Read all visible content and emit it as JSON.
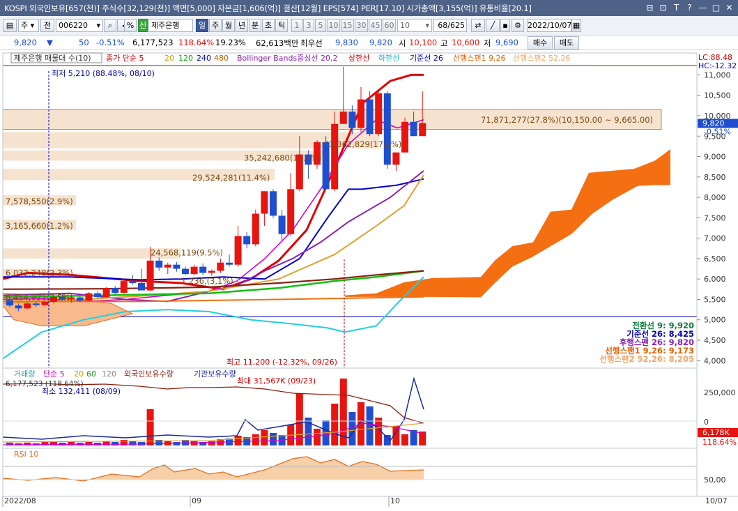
{
  "title": "KOSPI 외국인보유[657(천)] 주식수[32,129(천)] 액면[5,000] 자본금[1,606(억)] 결산[12월] EPS[574] PER[17.10] 시가총액[3,155(억)] 유통비율[20.1]",
  "window_buttons": [
    "⊟",
    "⊡",
    "T",
    "?",
    "—",
    "□",
    "✕"
  ],
  "toolbar": {
    "market": "주",
    "prev": "전",
    "code": "006220",
    "search_icon": "search-icon",
    "percent": "%",
    "sin": "신",
    "stock_name": "제주은행",
    "periods": [
      "일",
      "주",
      "월",
      "년",
      "분",
      "초",
      "틱"
    ],
    "active_period": "일",
    "nums": [
      "1",
      "3",
      "5",
      "10",
      "15",
      "30",
      "45",
      "60"
    ],
    "interval": "10",
    "count": "68",
    "total": "/625",
    "date": "2022/10/07"
  },
  "quote": {
    "price": "9,820",
    "arrow": "▼",
    "change": "50",
    "change_pct": "-0.51%",
    "volume": "6,177,523",
    "vol_ratio": "118.64%",
    "turnover": "19.23%",
    "amount": "62,613백만",
    "pref_label": "최우선",
    "pref1": "9,830",
    "pref2": "9,820",
    "open_label": "시",
    "open": "10,100",
    "high_label": "고",
    "high": "10,600",
    "low_label": "저",
    "low": "9,690",
    "buy": "매수",
    "sell": "매도"
  },
  "main_legend": {
    "name": "제주은행 매물대 수(10)",
    "ma_label": "종가 단순 5",
    "ma_periods": [
      "20",
      "120",
      "240",
      "480"
    ],
    "bb": "Bollinger Bands중심선 20,2",
    "upper": "상한선",
    "lower": "하한선",
    "base": "기준선 26",
    "lead1": "선행스팬1 9,26",
    "lead2": "선행스팬2 52,26"
  },
  "right_tags": {
    "lc": "LC:88.48",
    "hc": "HC:-12.32",
    "price": "9,820",
    "pct": "-0.51%",
    "vol": "6,178K",
    "volpct": "118.64%"
  },
  "annotations": {
    "low": "최저 5,210 (88.48%, 08/10)",
    "high": "최고 11,200 (-12.32%, 09/26)",
    "vol_max": "최대 31,567K (09/23)",
    "vol_min": "최소 132,411 (08/09)",
    "vol_cur": "6,177,523 (118.64%)"
  },
  "vp_labels": [
    "71,871,277(27.8%)(10,150.00 ~ 9,665.00)",
    "43,362,829(17.0%)",
    "35,242,680(13.7%)",
    "29,524,281(11.4%)",
    "7,578,550(2.9%)",
    "3,165,660(1.2%)",
    "24,568,119(9.5%)",
    "6,032,248(2.3%)",
    "6,454,923(2.5%)",
    "1,236,(3,1%)"
  ],
  "ichimoku": [
    {
      "label": "전환선 9: 9,920",
      "color": "#0a7a3a"
    },
    {
      "label": "기준선 26: 8,425",
      "color": "#0000aa"
    },
    {
      "label": "후행스팬 26: 9,820",
      "color": "#8a1fb5"
    },
    {
      "label": "선행스팬1 9,26: 9,173",
      "color": "#e06000"
    },
    {
      "label": "선행스팬2 52,26: 8,205",
      "color": "#f3a56a"
    }
  ],
  "vol_legend": {
    "title": "거래량",
    "ma": "단순 5",
    "p": [
      "20",
      "60",
      "120"
    ],
    "foreign": "외국인보유수량",
    "inst": "기관보유수량"
  },
  "rsi_legend": "RSI 10",
  "x_labels": [
    "2022/08",
    "09",
    "10",
    "10/07"
  ],
  "colors": {
    "up": "#e8140f",
    "down": "#1f4fcf",
    "cloud": "#f46f12",
    "bg_vp": "#f5e3cf"
  },
  "chart_data": {
    "type": "candlestick",
    "price_axis": {
      "min": 3800,
      "max": 11400,
      "ticks": [
        "11,000",
        "10,500",
        "10,000",
        "9,500",
        "9,000",
        "8,500",
        "8,000",
        "7,500",
        "7,000",
        "6,500",
        "6,000",
        "5,500",
        "5,000",
        "4,500",
        "4,000"
      ]
    },
    "candles": [
      [
        5480,
        5520,
        5300,
        5350
      ],
      [
        5350,
        5400,
        5210,
        5280
      ],
      [
        5280,
        5430,
        5260,
        5400
      ],
      [
        5400,
        5450,
        5320,
        5360
      ],
      [
        5360,
        5480,
        5330,
        5440
      ],
      [
        5440,
        5600,
        5400,
        5560
      ],
      [
        5560,
        5620,
        5470,
        5500
      ],
      [
        5500,
        5580,
        5420,
        5550
      ],
      [
        5550,
        5600,
        5440,
        5470
      ],
      [
        5470,
        5680,
        5450,
        5650
      ],
      [
        5650,
        5700,
        5520,
        5560
      ],
      [
        5560,
        5800,
        5540,
        5780
      ],
      [
        5780,
        5830,
        5620,
        5660
      ],
      [
        5660,
        6000,
        5640,
        5950
      ],
      [
        5950,
        6100,
        5860,
        5900
      ],
      [
        5900,
        6250,
        5850,
        5720
      ],
      [
        5720,
        6790,
        5700,
        6450
      ],
      [
        6450,
        6530,
        6200,
        6280
      ],
      [
        6280,
        6400,
        6120,
        6350
      ],
      [
        6350,
        6420,
        6180,
        6250
      ],
      [
        6250,
        6300,
        6100,
        6120
      ],
      [
        6120,
        6350,
        6100,
        6300
      ],
      [
        6300,
        6380,
        6100,
        6150
      ],
      [
        6150,
        6230,
        6080,
        6200
      ],
      [
        6200,
        6500,
        6150,
        6400
      ],
      [
        6400,
        6600,
        6300,
        6350
      ],
      [
        6350,
        7300,
        6300,
        7050
      ],
      [
        7050,
        7150,
        6750,
        6850
      ],
      [
        6850,
        7700,
        6800,
        7600
      ],
      [
        7600,
        8150,
        7300,
        8150
      ],
      [
        8150,
        8200,
        7500,
        7550
      ],
      [
        7550,
        7700,
        6950,
        7100
      ],
      [
        7100,
        8600,
        7050,
        8200
      ],
      [
        8200,
        9500,
        8150,
        9050
      ],
      [
        9050,
        9150,
        8450,
        8800
      ],
      [
        8800,
        9400,
        8700,
        9350
      ],
      [
        9350,
        9500,
        8300,
        8200
      ],
      [
        8200,
        10100,
        8150,
        9800
      ],
      [
        9800,
        11200,
        9900,
        10100
      ],
      [
        10100,
        10250,
        9550,
        9700
      ],
      [
        9700,
        10700,
        9600,
        10400
      ],
      [
        10400,
        10600,
        9500,
        9550
      ],
      [
        9550,
        10600,
        9500,
        10550
      ],
      [
        10550,
        10600,
        8700,
        8800
      ],
      [
        8800,
        9100,
        8650,
        9100
      ],
      [
        9100,
        9950,
        9100,
        9850
      ],
      [
        9850,
        10100,
        9500,
        9500
      ],
      [
        9500,
        10600,
        9690,
        9820
      ]
    ],
    "volume_axis": {
      "ticks": [
        "250,000",
        "0"
      ]
    },
    "rsi_axis": {
      "ticks": [
        "50,00"
      ]
    }
  }
}
